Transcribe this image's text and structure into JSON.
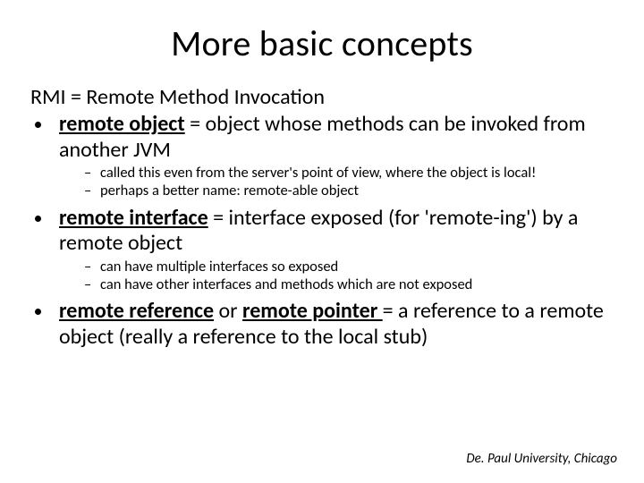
{
  "title": "More basic concepts",
  "rmi_line": "RMI = Remote Method Invocation",
  "bullets": [
    {
      "term": "remote object",
      "rest": " = object whose methods can be invoked from another JVM",
      "subs": [
        "called this even from the server's point of view, where the object is local!",
        "perhaps a better name: remote-able object"
      ]
    },
    {
      "term": "remote interface",
      "rest": " = interface exposed (for 'remote-ing') by a remote object",
      "subs": [
        "can have multiple interfaces so exposed",
        "can have other interfaces and methods which are not exposed"
      ]
    },
    {
      "term": "remote reference",
      "mid": " or ",
      "term2": "remote pointer ",
      "rest": "= a reference to a remote object (really a reference to the local stub)",
      "subs": []
    }
  ],
  "footer": "De. Paul University, Chicago"
}
